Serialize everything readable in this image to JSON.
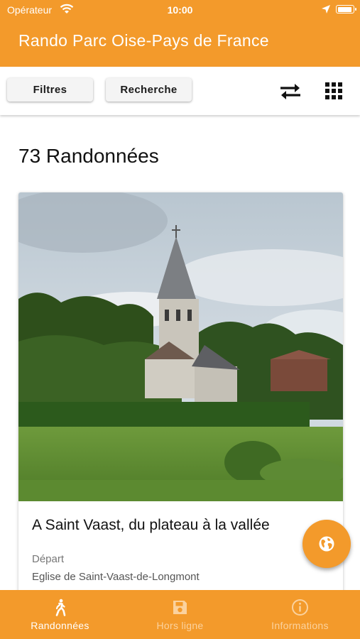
{
  "status_bar": {
    "carrier": "Opérateur",
    "time": "10:00"
  },
  "app": {
    "title": "Rando Parc Oise-Pays de France"
  },
  "toolbar": {
    "filters_label": "Filtres",
    "search_label": "Recherche"
  },
  "results": {
    "count_label": "73 Randonnées"
  },
  "cards": [
    {
      "title": "A Saint Vaast, du plateau à la vallée",
      "depart_label": "Départ",
      "depart_value": "Eglise de Saint-Vaast-de-Longmont"
    }
  ],
  "bottom_nav": [
    {
      "label": "Randonnées",
      "icon": "hiker-icon",
      "active": true
    },
    {
      "label": "Hors ligne",
      "icon": "save-icon",
      "active": false
    },
    {
      "label": "Informations",
      "icon": "info-icon",
      "active": false
    }
  ],
  "colors": {
    "brand": "#f39a2b",
    "nav_inactive_text": "#fbd29e"
  }
}
